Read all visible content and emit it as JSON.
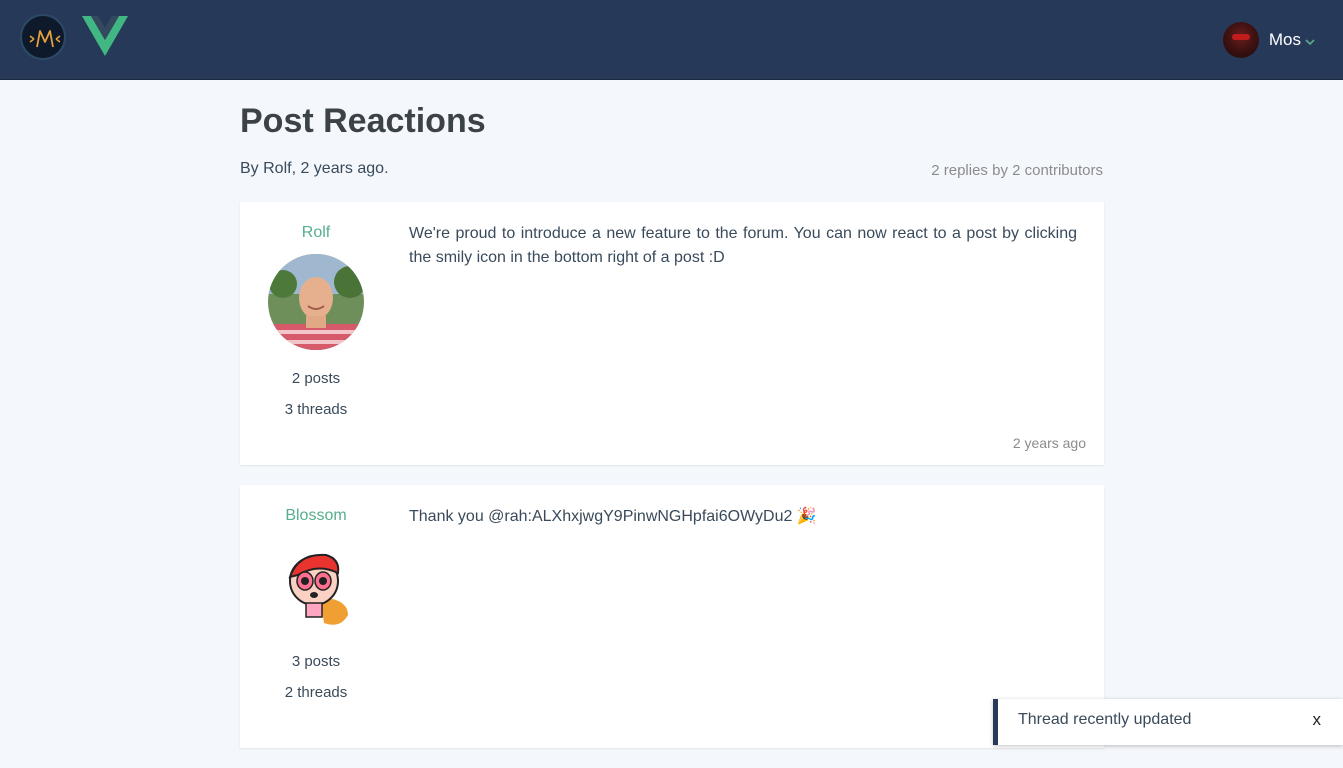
{
  "header": {
    "user_name": "Mos"
  },
  "thread": {
    "title": "Post Reactions",
    "byline": "By Rolf, 2 years ago.",
    "stats": "2 replies by 2 contributors"
  },
  "posts": [
    {
      "author": "Rolf",
      "posts_count": "2 posts",
      "threads_count": "3 threads",
      "text": "We're proud to introduce a new feature to the forum. You can now react to a post by clicking the smily icon in the bottom right of a post :D",
      "date": "2 years ago"
    },
    {
      "author": "Blossom",
      "posts_count": "3 posts",
      "threads_count": "2 threads",
      "text": "Thank you @rah:ALXhxjwgY9PinwNGHpfai6OWyDu2 🎉",
      "date": ""
    }
  ],
  "toast": {
    "message": "Thread recently updated",
    "close_label": "x"
  },
  "colors": {
    "navbar": "#263959",
    "accent": "#57ad8d",
    "background": "#f4f7fc"
  }
}
